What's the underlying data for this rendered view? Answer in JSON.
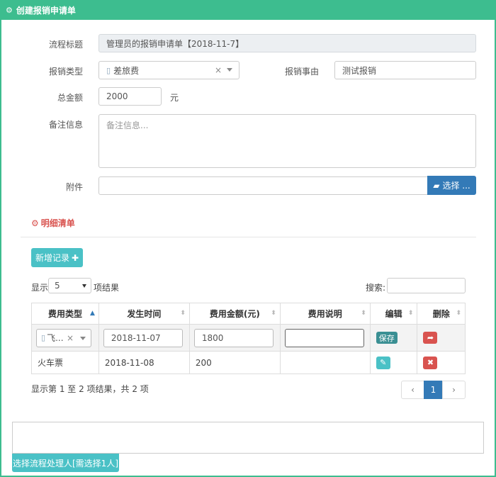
{
  "window": {
    "title": "创建报销申请单"
  },
  "form": {
    "process_title_label": "流程标题",
    "process_title_value": "管理员的报销申请单【2018-11-7】",
    "type_label": "报销类型",
    "type_value": "差旅费",
    "type_clear": "×",
    "reason_label": "报销事由",
    "reason_value": "测试报销",
    "amount_label": "总金额",
    "amount_value": "2000",
    "amount_unit": "元",
    "notes_label": "备注信息",
    "notes_placeholder": "备注信息...",
    "attachment_label": "附件",
    "attachment_button": "选择 ..."
  },
  "detail": {
    "section_title": "明细清单",
    "add_button": "新增记录",
    "show_prefix": "显示",
    "page_size": "5",
    "show_suffix": "项结果",
    "search_label": "搜索:",
    "columns": [
      "费用类型",
      "发生时间",
      "费用金额(元)",
      "费用说明",
      "编辑",
      "删除"
    ],
    "editing_row": {
      "type": "飞...",
      "type_clear": "×",
      "date": "2018-11-07",
      "amount": "1800",
      "note": "",
      "save_label": "保存"
    },
    "rows": [
      {
        "type": "火车票",
        "date": "2018-11-08",
        "amount": "200",
        "note": ""
      }
    ],
    "summary": "显示第 1 至 2 项结果，共 2 项",
    "pager": {
      "prev": "‹",
      "current": "1",
      "next": "›"
    }
  },
  "footer": {
    "handler_button": "选择流程处理人[需选择1人]"
  },
  "colors": {
    "header_green": "#3dbd8f",
    "primary_blue": "#337ab7",
    "teal": "#4ac1c6",
    "danger_red": "#d9534f"
  },
  "icons": [
    "cogs-icon",
    "file-icon",
    "folder-open-icon",
    "gear-icon",
    "plus-icon",
    "sort-icon",
    "share-icon",
    "edit-icon",
    "times-icon"
  ]
}
